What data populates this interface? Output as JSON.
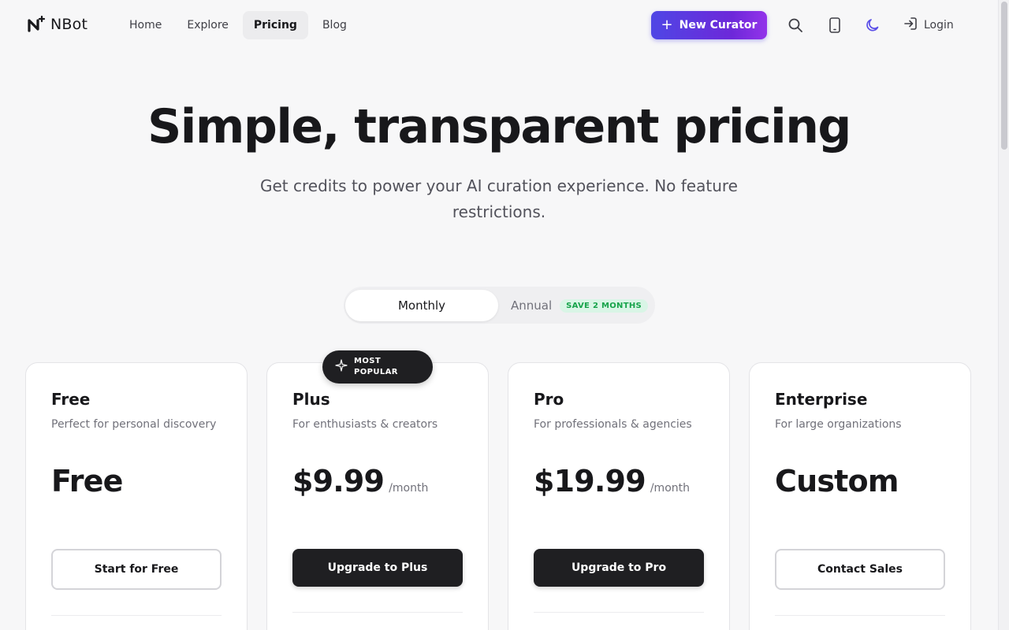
{
  "brand": {
    "name": "NBot"
  },
  "nav": {
    "items": [
      {
        "label": "Home",
        "active": false
      },
      {
        "label": "Explore",
        "active": false
      },
      {
        "label": "Pricing",
        "active": true
      },
      {
        "label": "Blog",
        "active": false
      }
    ]
  },
  "header": {
    "new_curator_label": "New Curator",
    "login_label": "Login",
    "icons": [
      "search-icon",
      "mobile-icon",
      "moon-icon",
      "login-icon"
    ]
  },
  "hero": {
    "title": "Simple, transparent pricing",
    "subtitle": "Get credits to power your AI curation experience. No feature restrictions."
  },
  "billing": {
    "monthly_label": "Monthly",
    "annual_label": "Annual",
    "annual_badge": "SAVE 2 MONTHS",
    "selected": "Monthly"
  },
  "plans": [
    {
      "name": "Free",
      "description": "Perfect for personal discovery",
      "price": "Free",
      "period": "",
      "button": "Start for Free",
      "button_style": "outline"
    },
    {
      "name": "Plus",
      "description": "For enthusiasts & creators",
      "price": "$9.99",
      "period": "/month",
      "button": "Upgrade to Plus",
      "button_style": "solid",
      "badge": "MOST POPULAR"
    },
    {
      "name": "Pro",
      "description": "For professionals & agencies",
      "price": "$19.99",
      "period": "/month",
      "button": "Upgrade to Pro",
      "button_style": "solid"
    },
    {
      "name": "Enterprise",
      "description": "For large organizations",
      "price": "Custom",
      "period": "",
      "button": "Contact Sales",
      "button_style": "outline"
    }
  ],
  "colors": {
    "accent_start": "#4f46e5",
    "accent_end": "#9333ea",
    "badge_green": "#16a34a",
    "dark_button": "#1f1f22"
  }
}
